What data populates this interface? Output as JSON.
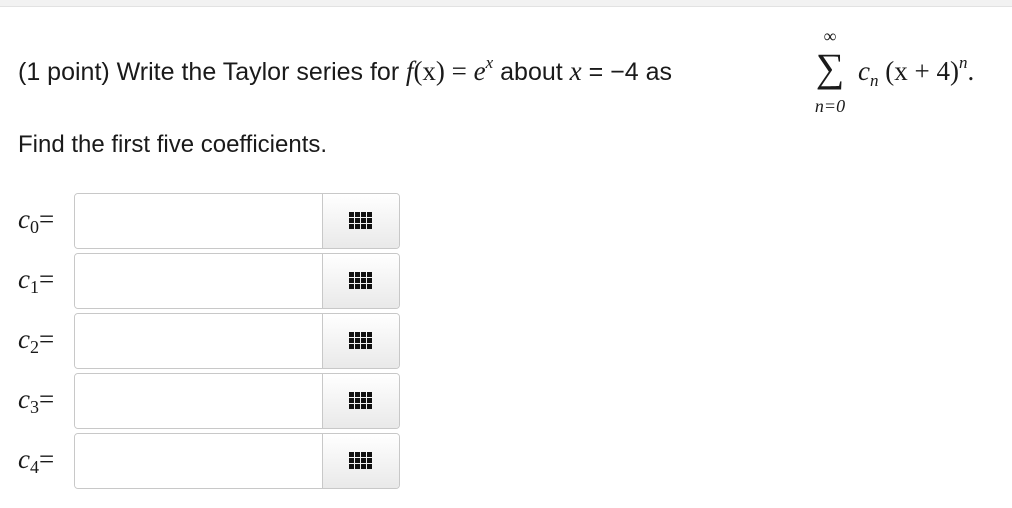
{
  "question": {
    "prefix": "(1 point) Write the Taylor series for ",
    "func_f": "f",
    "func_arg": "(x)",
    "equals": " = ",
    "base": "e",
    "exponent": "x",
    "about": " about ",
    "var": "x",
    "equals2": " = −4 as ",
    "sigma_upper": "∞",
    "sigma_symbol": "∑",
    "sigma_lower": "n=0",
    "coef": "c",
    "coef_sub": "n",
    "term": "(x + 4)",
    "term_exp": "n",
    "period": "."
  },
  "instruction": "Find the first five coefficients.",
  "answers": [
    {
      "var": "c",
      "sub": "0",
      "eq": "=",
      "value": ""
    },
    {
      "var": "c",
      "sub": "1",
      "eq": "=",
      "value": ""
    },
    {
      "var": "c",
      "sub": "2",
      "eq": "=",
      "value": ""
    },
    {
      "var": "c",
      "sub": "3",
      "eq": "=",
      "value": ""
    },
    {
      "var": "c",
      "sub": "4",
      "eq": "=",
      "value": ""
    }
  ],
  "icons": {
    "palette": "grid-icon"
  },
  "colors": {
    "text": "#1a1a1a",
    "border": "#c8c8c8",
    "icon": "#111111"
  }
}
